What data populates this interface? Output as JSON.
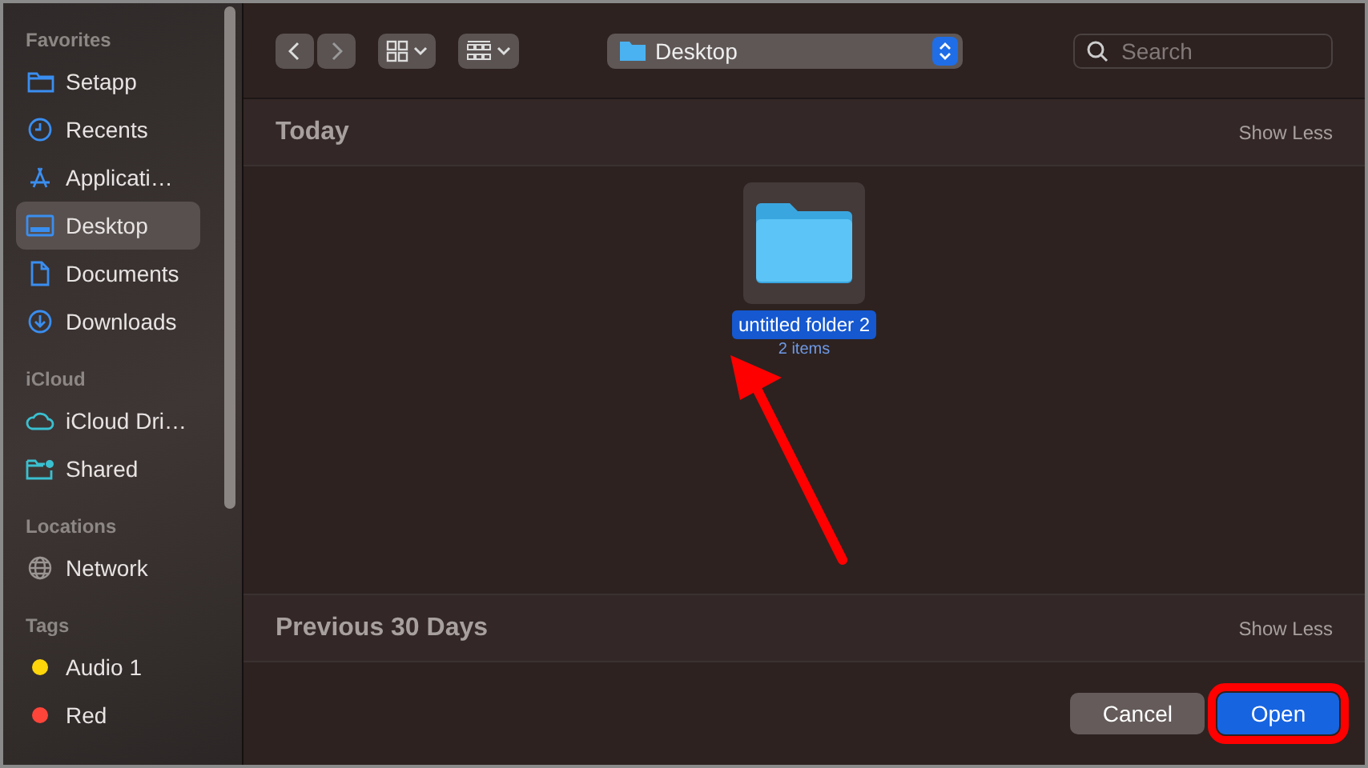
{
  "sidebar": {
    "sections": [
      {
        "title": "Favorites",
        "items": [
          {
            "label": "Setapp",
            "selected": false
          },
          {
            "label": "Recents",
            "selected": false
          },
          {
            "label": "Applicati…",
            "selected": false
          },
          {
            "label": "Desktop",
            "selected": true
          },
          {
            "label": "Documents",
            "selected": false
          },
          {
            "label": "Downloads",
            "selected": false
          }
        ]
      },
      {
        "title": "iCloud",
        "items": [
          {
            "label": "iCloud Dri…",
            "selected": false
          },
          {
            "label": "Shared",
            "selected": false
          }
        ]
      },
      {
        "title": "Locations",
        "items": [
          {
            "label": "Network",
            "selected": false
          }
        ]
      },
      {
        "title": "Tags",
        "items": [
          {
            "label": "Audio 1",
            "color": "#ffd60a",
            "selected": false
          },
          {
            "label": "Red",
            "color": "#ff453a",
            "selected": false
          }
        ]
      }
    ]
  },
  "toolbar": {
    "location": "Desktop",
    "search": {
      "placeholder": "Search"
    }
  },
  "groups": [
    {
      "title": "Today",
      "action": "Show Less",
      "items": [
        {
          "name": "untitled folder 2",
          "detail": "2 items",
          "selected": true
        }
      ]
    },
    {
      "title": "Previous 30 Days",
      "action": "Show Less"
    }
  ],
  "buttons": [
    {
      "label": "Cancel",
      "kind": "secondary",
      "highlighted": false
    },
    {
      "label": "Open",
      "kind": "primary",
      "highlighted": true
    }
  ]
}
